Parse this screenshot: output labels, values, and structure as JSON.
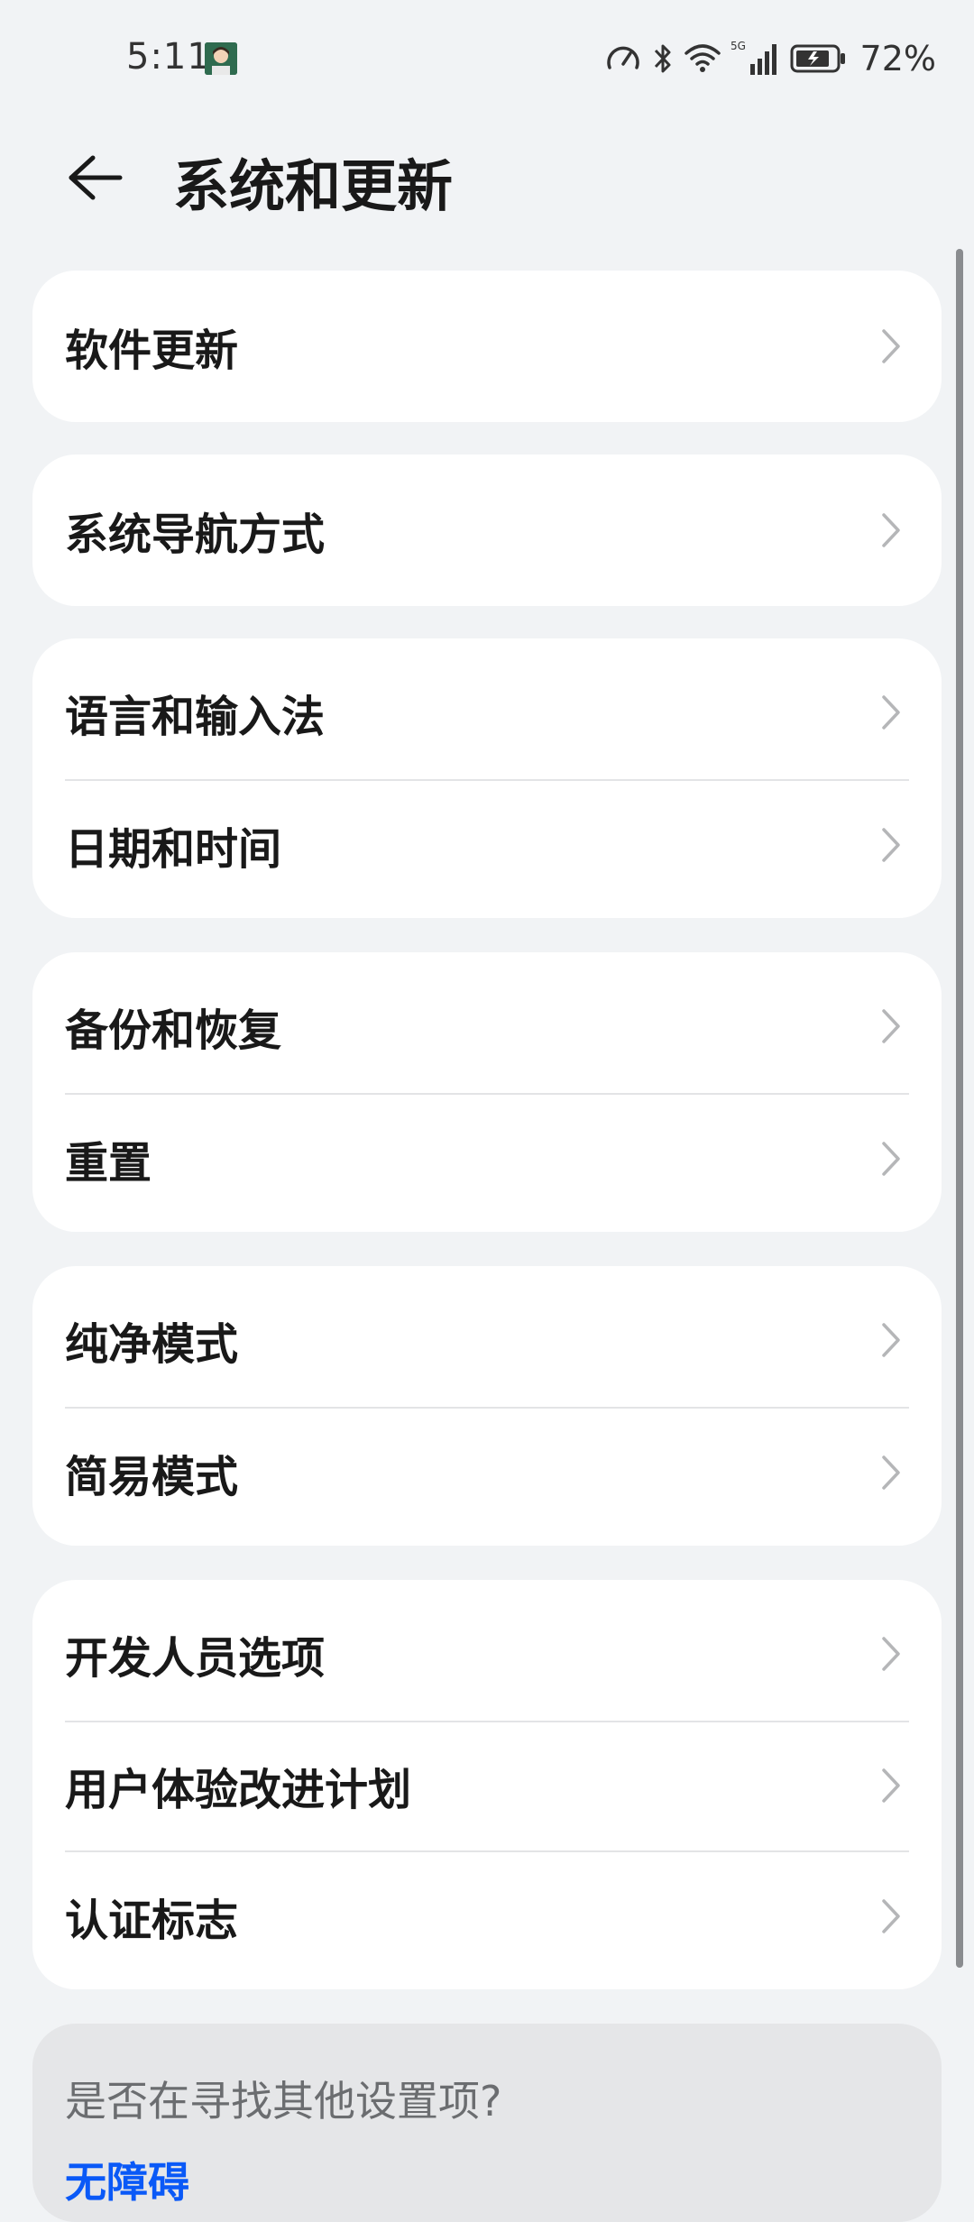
{
  "status_bar": {
    "time": "5:11",
    "battery_percent": "72%",
    "network": "5G"
  },
  "header": {
    "title": "系统和更新"
  },
  "groups": [
    {
      "items": [
        {
          "label": "软件更新"
        }
      ]
    },
    {
      "items": [
        {
          "label": "系统导航方式"
        }
      ]
    },
    {
      "items": [
        {
          "label": "语言和输入法"
        },
        {
          "label": "日期和时间"
        }
      ]
    },
    {
      "items": [
        {
          "label": "备份和恢复"
        },
        {
          "label": "重置"
        }
      ]
    },
    {
      "items": [
        {
          "label": "纯净模式"
        },
        {
          "label": "简易模式"
        }
      ]
    },
    {
      "items": [
        {
          "label": "开发人员选项"
        },
        {
          "label": "用户体验改进计划"
        },
        {
          "label": "认证标志"
        }
      ]
    }
  ],
  "suggestion": {
    "question": "是否在寻找其他设置项?",
    "link": "无障碍"
  },
  "colors": {
    "background": "#f1f3f5",
    "card": "#ffffff",
    "link": "#0a59f7"
  }
}
